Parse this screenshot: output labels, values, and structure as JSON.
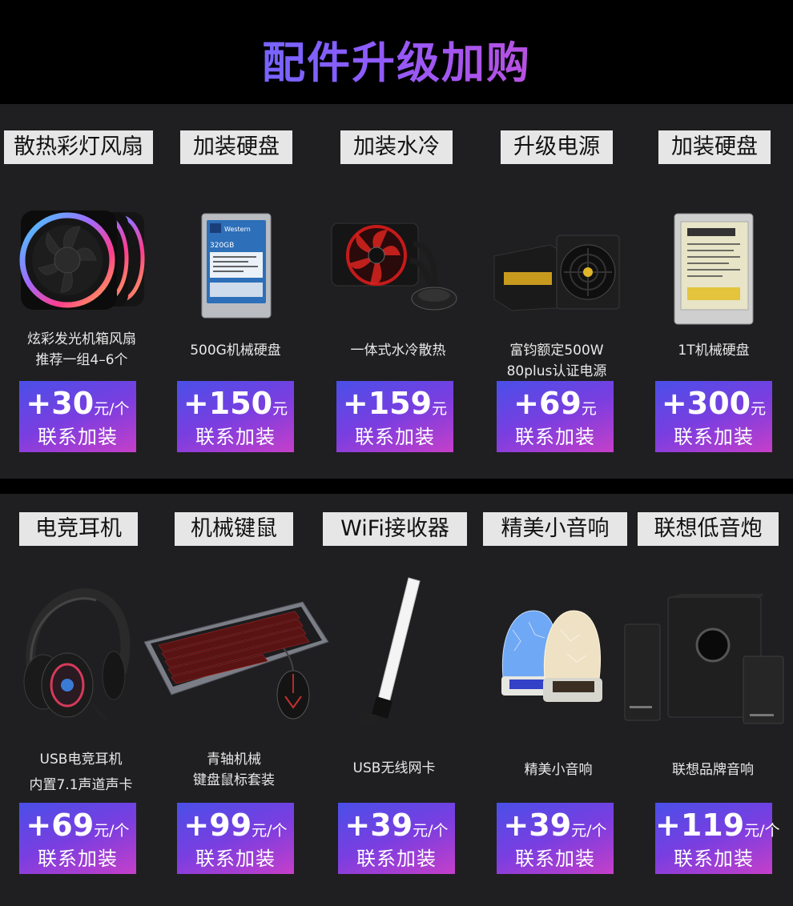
{
  "title": "配件升级加购",
  "row1": [
    {
      "tag": "散热彩灯风扇",
      "desc1": "炫彩发光机箱风扇",
      "desc2": "推荐一组4–6个",
      "plus": "+",
      "price": "30",
      "unit": "元/个",
      "cta": "联系加装",
      "icon": "rgb-fan-icon"
    },
    {
      "tag": "加装硬盘",
      "desc1": "500G机械硬盘",
      "desc2": "",
      "plus": "+",
      "price": "150",
      "unit": "元",
      "cta": "联系加装",
      "icon": "hard-drive-icon"
    },
    {
      "tag": "加装水冷",
      "desc1": "一体式水冷散热",
      "desc2": "",
      "plus": "+",
      "price": "159",
      "unit": "元",
      "cta": "联系加装",
      "icon": "water-cooler-icon"
    },
    {
      "tag": "升级电源",
      "desc1": "富钧额定500W",
      "desc2": "80plus认证电源",
      "plus": "+",
      "price": "69",
      "unit": "元",
      "cta": "联系加装",
      "icon": "power-supply-icon"
    },
    {
      "tag": "加装硬盘",
      "desc1": "1T机械硬盘",
      "desc2": "",
      "plus": "+",
      "price": "300",
      "unit": "元",
      "cta": "联系加装",
      "icon": "hard-drive-1t-icon"
    }
  ],
  "row2": [
    {
      "tag": "电竞耳机",
      "desc1": "USB电竞耳机",
      "desc2": "内置7.1声道声卡",
      "plus": "+",
      "price": "69",
      "unit": "元/个",
      "cta": "联系加装",
      "icon": "gaming-headset-icon"
    },
    {
      "tag": "机械键鼠",
      "desc1": "青轴机械",
      "desc2": "键盘鼠标套装",
      "plus": "+",
      "price": "99",
      "unit": "元/个",
      "cta": "联系加装",
      "icon": "keyboard-mouse-icon"
    },
    {
      "tag": "WiFi接收器",
      "desc1": "USB无线网卡",
      "desc2": "",
      "plus": "+",
      "price": "39",
      "unit": "元/个",
      "cta": "联系加装",
      "icon": "wifi-adapter-icon"
    },
    {
      "tag": "精美小音响",
      "desc1": "精美小音响",
      "desc2": "",
      "plus": "+",
      "price": "39",
      "unit": "元/个",
      "cta": "联系加装",
      "icon": "mini-speakers-icon"
    },
    {
      "tag": "联想低音炮",
      "desc1": "联想品牌音响",
      "desc2": "",
      "plus": "+",
      "price": "119",
      "unit": "元/个",
      "cta": "联系加装",
      "icon": "subwoofer-icon"
    }
  ]
}
